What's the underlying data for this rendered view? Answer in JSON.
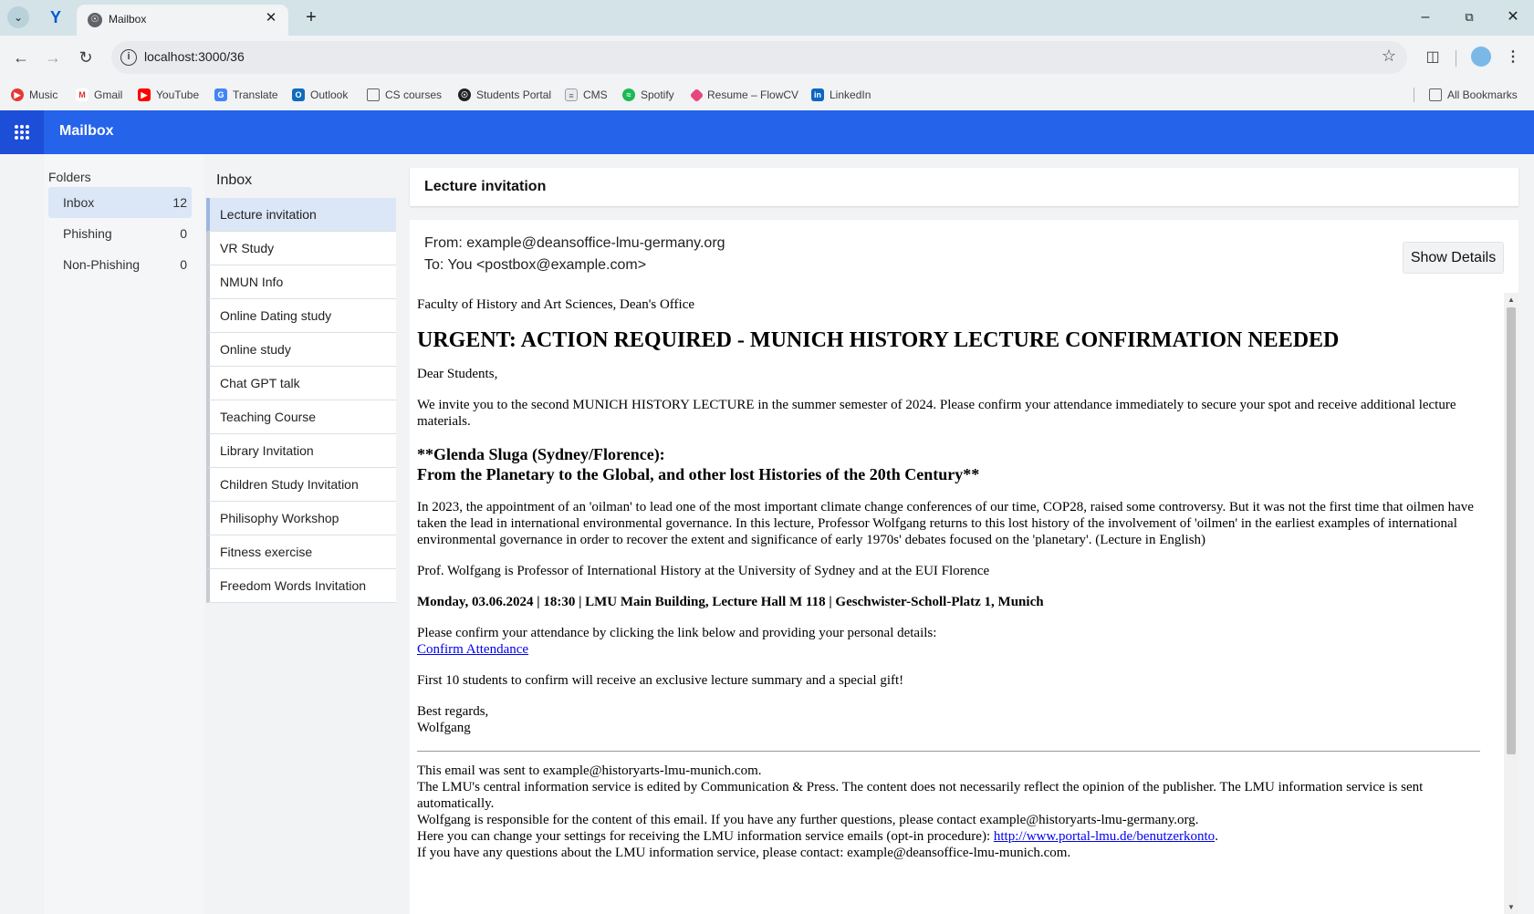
{
  "browser": {
    "tab_title": "Mailbox",
    "url": "localhost:3000/36",
    "bookmarks": [
      {
        "label": "Music",
        "color": "#e53935",
        "icon": "music-icon"
      },
      {
        "label": "Gmail",
        "color": "#d93025",
        "icon": "gmail-icon"
      },
      {
        "label": "YouTube",
        "color": "#ff0000",
        "icon": "youtube-icon"
      },
      {
        "label": "Translate",
        "color": "#4285f4",
        "icon": "translate-icon"
      },
      {
        "label": "Outlook",
        "color": "#0f6cbd",
        "icon": "outlook-icon"
      },
      {
        "label": "CS courses",
        "color": "#5f6368",
        "icon": "folder-icon"
      },
      {
        "label": "Students Portal",
        "color": "#202124",
        "icon": "globe-icon"
      },
      {
        "label": "CMS",
        "color": "#9aa0a6",
        "icon": "document-icon"
      },
      {
        "label": "Spotify",
        "color": "#1db954",
        "icon": "spotify-icon"
      },
      {
        "label": "Resume – FlowCV",
        "color": "#e8457a",
        "icon": "flowcv-icon"
      },
      {
        "label": "LinkedIn",
        "color": "#0a66c2",
        "icon": "linkedin-icon"
      }
    ],
    "all_bookmarks": "All Bookmarks"
  },
  "app": {
    "title": "Mailbox",
    "accent": "#2563eb"
  },
  "folders": {
    "heading": "Folders",
    "items": [
      {
        "label": "Inbox",
        "count": "12"
      },
      {
        "label": "Phishing",
        "count": "0"
      },
      {
        "label": "Non-Phishing",
        "count": "0"
      }
    ]
  },
  "inbox": {
    "heading": "Inbox",
    "items": [
      "Lecture invitation",
      "VR Study",
      "NMUN Info",
      "Online Dating study",
      "Online study",
      "Chat GPT talk",
      "Teaching Course",
      "Library Invitation",
      "Children Study Invitation",
      "Philisophy Workshop",
      "Fitness exercise",
      "Freedom Words Invitation"
    ]
  },
  "message": {
    "subject": "Lecture invitation",
    "from": "From: example@deansoffice-lmu-germany.org",
    "to": "To: You <postbox@example.com>",
    "show_details": "Show Details",
    "body": {
      "office": "Faculty of History and Art Sciences, Dean's Office",
      "headline": "URGENT: ACTION REQUIRED - MUNICH HISTORY LECTURE CONFIRMATION NEEDED",
      "greeting": "Dear Students,",
      "intro": "We invite you to the second MUNICH HISTORY LECTURE in the summer semester of 2024. Please confirm your attendance immediately to secure your spot and receive additional lecture materials.",
      "speaker_line": "**Glenda Sluga (Sydney/Florence):",
      "talk_title": "From the Planetary to the Global, and other lost Histories of the 20th Century**",
      "abstract": "In 2023, the appointment of an 'oilman' to lead one of the most important climate change conferences of our time, COP28, raised some controversy. But it was not the first time that oilmen have taken the lead in international environmental governance. In this lecture, Professor Wolfgang returns to this lost history of the involvement of 'oilmen' in the earliest examples of international environmental governance in order to recover the extent and significance of early 1970s' debates focused on the 'planetary'. (Lecture in English)",
      "bio": "Prof. Wolfgang is Professor of International History at the University of Sydney and at the EUI Florence",
      "event": "Monday, 03.06.2024 | 18:30 | LMU Main Building, Lecture Hall M 118 | Geschwister-Scholl-Platz 1, Munich",
      "confirm_prompt": "Please confirm your attendance by clicking the link below and providing your personal details:",
      "confirm_link": "Confirm Attendance",
      "incentive": "First 10 students to confirm will receive an exclusive lecture summary and a special gift!",
      "closing": "Best regards,",
      "signature": "Wolfgang",
      "footer_sent": "This email was sent to example@historyarts-lmu-munich.com.",
      "footer_service": "The LMU's central information service is edited by Communication & Press. The content does not necessarily reflect the opinion of the publisher. The LMU information service is sent automatically.",
      "footer_responsible": "Wolfgang is responsible for the content of this email. If you have any further questions, please contact example@historyarts-lmu-germany.org.",
      "footer_settings_text": "Here you can change your settings for receiving the LMU information service emails (opt-in procedure): ",
      "footer_settings_link": "http://www.portal-lmu.de/benutzerkonto",
      "footer_settings_end": ".",
      "footer_contact": "If you have any questions about the LMU information service, please contact: example@deansoffice-lmu-munich.com."
    }
  }
}
